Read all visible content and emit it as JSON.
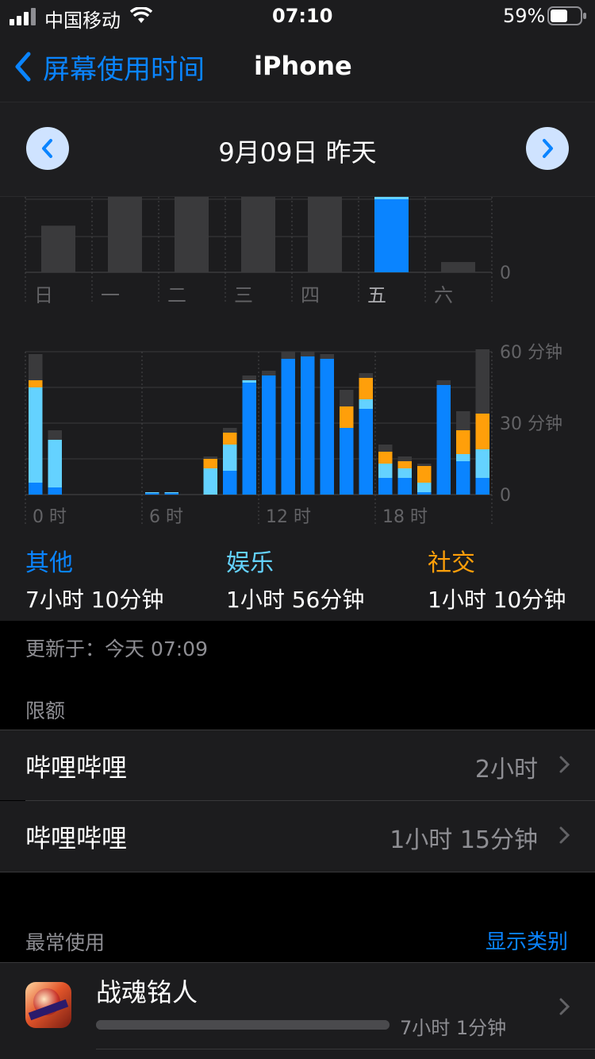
{
  "status_bar": {
    "carrier": "中国移动",
    "time": "07:10",
    "battery": "59%"
  },
  "nav": {
    "back_label": "屏幕使用时间",
    "title": "iPhone"
  },
  "day": {
    "label": "9月09日 昨天"
  },
  "weekly_chart": {
    "days": [
      "日",
      "一",
      "二",
      "三",
      "四",
      "五",
      "六"
    ],
    "zero_label": "0"
  },
  "hourly_chart": {
    "y_labels": [
      "60 分钟",
      "30 分钟",
      "0"
    ],
    "x_labels": [
      "0 时",
      "6 时",
      "12 时",
      "18 时"
    ]
  },
  "categories": [
    {
      "name": "其他",
      "time": "7小时 10分钟",
      "color": "#0a84ff"
    },
    {
      "name": "娱乐",
      "time": "1小时 56分钟",
      "color": "#64d2ff"
    },
    {
      "name": "社交",
      "time": "1小时 10分钟",
      "color": "#ff9f0a"
    }
  ],
  "updated": "更新于：今天 07:09",
  "limits": {
    "header": "限额",
    "items": [
      {
        "name": "哔哩哔哩",
        "value": "2小时"
      },
      {
        "name": "哔哩哔哩",
        "value": "1小时 15分钟"
      }
    ]
  },
  "most_used": {
    "header": "最常使用",
    "show_categories": "显示类别",
    "apps": [
      {
        "name": "战魂铭人",
        "time": "7小时 1分钟",
        "fraction": 1.0
      }
    ]
  },
  "colors": {
    "blue": "#0a84ff",
    "cyan": "#64d2ff",
    "orange": "#ff9f0a",
    "gray": "#3a3a3c"
  },
  "chart_data": [
    {
      "type": "bar",
      "categories": [
        "日",
        "一",
        "二",
        "三",
        "四",
        "五",
        "六"
      ],
      "values": [
        0.68,
        1.1,
        1.1,
        1.1,
        1.1,
        1.1,
        0.15
      ],
      "highlight_index": 5,
      "ylim": [
        0,
        1.1
      ]
    },
    {
      "type": "bar",
      "categories": [
        "0",
        "1",
        "2",
        "3",
        "4",
        "5",
        "6",
        "7",
        "8",
        "9",
        "10",
        "11",
        "12",
        "13",
        "14",
        "15",
        "16",
        "17",
        "18",
        "19",
        "20",
        "21",
        "22",
        "23"
      ],
      "ylim": [
        0,
        60
      ],
      "series": [
        {
          "name": "其他",
          "values": [
            5,
            3,
            0,
            0,
            0,
            0,
            0.6,
            0.6,
            0,
            0,
            10,
            47,
            50,
            57,
            58,
            57,
            28,
            36,
            7,
            7,
            1,
            46,
            14,
            7
          ]
        },
        {
          "name": "娱乐",
          "values": [
            40,
            20,
            0,
            0,
            0,
            0,
            0.4,
            0.4,
            0,
            11,
            11,
            1,
            0,
            0,
            0,
            0,
            0,
            4,
            6,
            4,
            4,
            0,
            3,
            12
          ]
        },
        {
          "name": "社交",
          "values": [
            3,
            0,
            0,
            0,
            0,
            0,
            0,
            0,
            0,
            4,
            5,
            0,
            0,
            0,
            0,
            0,
            9,
            9,
            5,
            3,
            7,
            0,
            10,
            15
          ]
        },
        {
          "values": [
            11,
            4,
            0,
            0,
            0,
            0,
            0,
            0,
            0,
            1,
            2,
            2,
            2,
            3,
            2,
            2,
            7,
            2,
            3,
            2,
            1,
            2,
            8,
            27
          ]
        }
      ]
    }
  ]
}
